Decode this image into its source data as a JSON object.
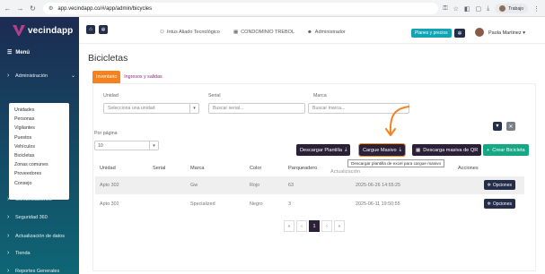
{
  "browser": {
    "url": "app.vecindapp.co/#/app/admin/bicycles",
    "profile_label": "Trabajo"
  },
  "brand": {
    "name": "vecindapp",
    "logo_color": "#b43f8c"
  },
  "sidebar": {
    "menu_label": "Menú",
    "admin_section": "Administración",
    "admin_subitems": [
      "Unidades",
      "Personas",
      "Vigilantes",
      "Puestos",
      "Vehículos",
      "Bicicletas",
      "Zonas comunes",
      "Proveedores",
      "Consejo"
    ],
    "items": [
      "Comunicaciones",
      "Seguridad 360",
      "Actualización de datos",
      "Tienda",
      "Reportes Generales"
    ]
  },
  "topbar": {
    "partner": "Intus Aliado Tecnológico",
    "condominium": "CONDOMINIO TREBOL",
    "role": "Administrador",
    "plans_label": "Planes y precios",
    "user_name": "Paola Martinez"
  },
  "page": {
    "title": "Bicicletas",
    "tabs": [
      "Inventario",
      "Ingresos y salidas"
    ],
    "active_tab": "Inventario"
  },
  "filters": {
    "unit_label": "Unidad",
    "unit_placeholder": "Selecciona una unidad",
    "serial_label": "Serial",
    "serial_placeholder": "Buscar serial...",
    "brand_label": "Marca",
    "brand_placeholder": "Buscar marca..."
  },
  "per_page": {
    "label": "Por página",
    "value": "10"
  },
  "actions": {
    "download_template": "Descargar Plantilla",
    "bulk_upload": "Cargue Masivo",
    "download_qr": "Descarga masiva de QR",
    "create": "Crear Bicicleta",
    "tooltip": "Descargar plantilla de excel para cargue masivo"
  },
  "table": {
    "headers": [
      "Unidad",
      "Serial",
      "Marca",
      "Color",
      "Parqueadero",
      "Actualización",
      "Acciones"
    ],
    "rows": [
      {
        "unit": "Apto 302",
        "serial": "",
        "brand": "Gw",
        "color": "Rojo",
        "parking": "63",
        "updated": "2025-06-26 14:55:25",
        "action": "Opciones"
      },
      {
        "unit": "Apto 302",
        "serial": "",
        "brand": "Specialized",
        "color": "Negro",
        "parking": "3",
        "updated": "2025-06-11 19:50:55",
        "action": "Opciones"
      }
    ]
  },
  "pagination": {
    "first": "«",
    "prev": "‹",
    "current": "1",
    "next": "›",
    "last": "»"
  },
  "colors": {
    "accent_orange": "#f5821f",
    "dark_button": "#2b2037",
    "teal_button": "#16a884",
    "sidebar_top": "#1c2b52",
    "sidebar_bottom": "#0e6675"
  }
}
